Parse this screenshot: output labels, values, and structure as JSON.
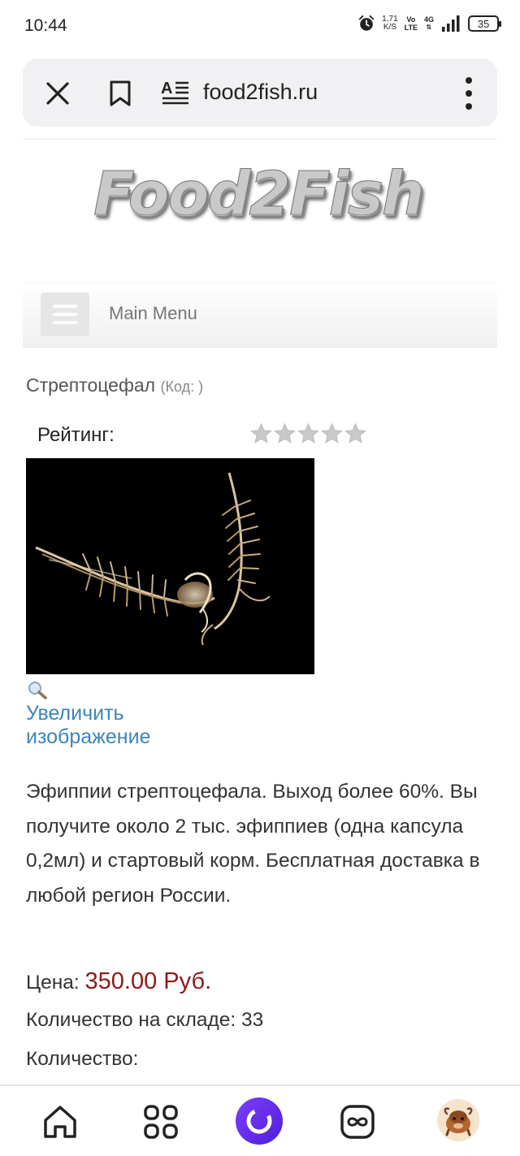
{
  "status_bar": {
    "time": "10:44",
    "net_speed_value": "1,71",
    "net_speed_unit": "K/S",
    "volte_top": "Vo",
    "volte_bottom": "LTE",
    "network": "4G",
    "battery": "35",
    "icons": [
      "alarm-icon",
      "signal-icon",
      "battery-icon"
    ]
  },
  "browser": {
    "url": "food2fish.ru",
    "icons": [
      "close-icon",
      "bookmark-icon",
      "reader-mode-icon",
      "more-menu-icon"
    ]
  },
  "site": {
    "logo_text": "Food2Fish",
    "menu_label": "Main Menu"
  },
  "product": {
    "title": "Стрептоцефал",
    "code_label": "(Код: )",
    "rating_label": "Рейтинг:",
    "rating_value": 0,
    "rating_max": 5,
    "zoom_link": "Увеличить изображение",
    "description": "Эфиппии стрептоцефала. Выход более 60%. Вы получите около 2 тыс. эфиппиев (одна капсула 0,2мл) и стартовый корм. Бесплатная доставка в любой регион России.",
    "price_label": "Цена:",
    "price_value": "350.00 Руб.",
    "stock_text": "Количество на складе: 33",
    "quantity_label": "Количество:"
  },
  "bottom_nav": {
    "items": [
      "home-icon",
      "apps-grid-icon",
      "alice-assistant-icon",
      "tabs-icon",
      "profile-avatar"
    ]
  },
  "colors": {
    "link": "#3d85b8",
    "price": "#8b1a1a",
    "alice": "#6a2ff0",
    "browser_bar": "#f1f1f3"
  }
}
